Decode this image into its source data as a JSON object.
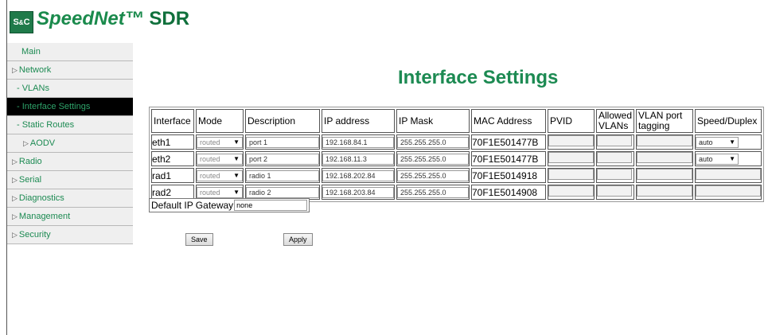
{
  "header": {
    "logo_top": "S",
    "logo_mid": "&",
    "logo_bottom": "C",
    "brand": "SpeedNet™",
    "product": "SDR"
  },
  "sidebar": {
    "items": [
      {
        "label": "Main",
        "level": 0
      },
      {
        "label": "Network",
        "level": 0,
        "expandable": true
      },
      {
        "label": "- VLANs",
        "level": 1
      },
      {
        "label": "- Interface Settings",
        "level": 1,
        "active": true
      },
      {
        "label": "- Static Routes",
        "level": 1
      },
      {
        "label": "AODV",
        "level": 2,
        "expandable": true
      },
      {
        "label": "Radio",
        "level": 0,
        "expandable": true
      },
      {
        "label": "Serial",
        "level": 0,
        "expandable": true
      },
      {
        "label": "Diagnostics",
        "level": 0,
        "expandable": true
      },
      {
        "label": "Management",
        "level": 0,
        "expandable": true
      },
      {
        "label": "Security",
        "level": 0,
        "expandable": true
      }
    ]
  },
  "main": {
    "title": "Interface Settings",
    "table": {
      "headers": [
        "Interface",
        "Mode",
        "Description",
        "IP address",
        "IP Mask",
        "MAC Address",
        "PVID",
        "Allowed VLANs",
        "VLAN port tagging",
        "Speed/Duplex"
      ],
      "rows": [
        {
          "iface": "eth1",
          "mode": "routed",
          "desc": "port 1",
          "ip": "192.168.84.1",
          "mask": "255.255.255.0",
          "mac": "70F1E501477B",
          "speed": "auto"
        },
        {
          "iface": "eth2",
          "mode": "routed",
          "desc": "port 2",
          "ip": "192.168.11.3",
          "mask": "255.255.255.0",
          "mac": "70F1E501477B",
          "speed": "auto"
        },
        {
          "iface": "rad1",
          "mode": "routed",
          "desc": "radio 1",
          "ip": "192.168.202.84",
          "mask": "255.255.255.0",
          "mac": "70F1E5014918",
          "speed": ""
        },
        {
          "iface": "rad2",
          "mode": "routed",
          "desc": "radio 2",
          "ip": "192.168.203.84",
          "mask": "255.255.255.0",
          "mac": "70F1E5014908",
          "speed": ""
        }
      ]
    },
    "gateway": {
      "label": "Default IP Gateway",
      "value": "none"
    },
    "buttons": {
      "save": "Save",
      "apply": "Apply"
    }
  },
  "colors": {
    "accent": "#1c8a52",
    "active_bg": "#000000",
    "logo_bg": "#1f7a4a"
  },
  "icons": {
    "expand": "triangle-right-icon",
    "dropdown": "chevron-down-icon"
  }
}
